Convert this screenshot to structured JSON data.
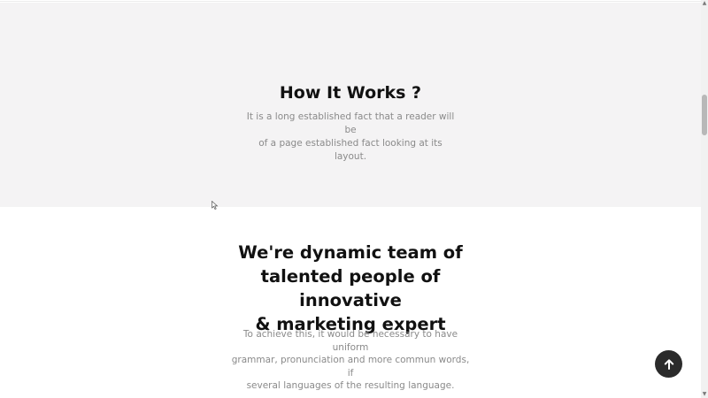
{
  "how_it_works": {
    "title": "How It Works ?",
    "description_line1": "It is a long established fact that a reader will be",
    "description_line2": "of a page established fact looking at its layout."
  },
  "team": {
    "title_line1": "We're dynamic team of",
    "title_line2": "talented people of innovative",
    "title_line3": "& marketing expert",
    "description_line1": "To achieve this, it would be necessary to have uniform",
    "description_line2": "grammar, pronunciation and more commun words, if",
    "description_line3": "several languages of the resulting language."
  },
  "back_to_top": {
    "icon": "arrow-up-icon",
    "color": "#2b2b2b"
  },
  "colors": {
    "section_bg": "#f4f3f4",
    "heading": "#111111",
    "body_text": "#8a8a8a"
  }
}
